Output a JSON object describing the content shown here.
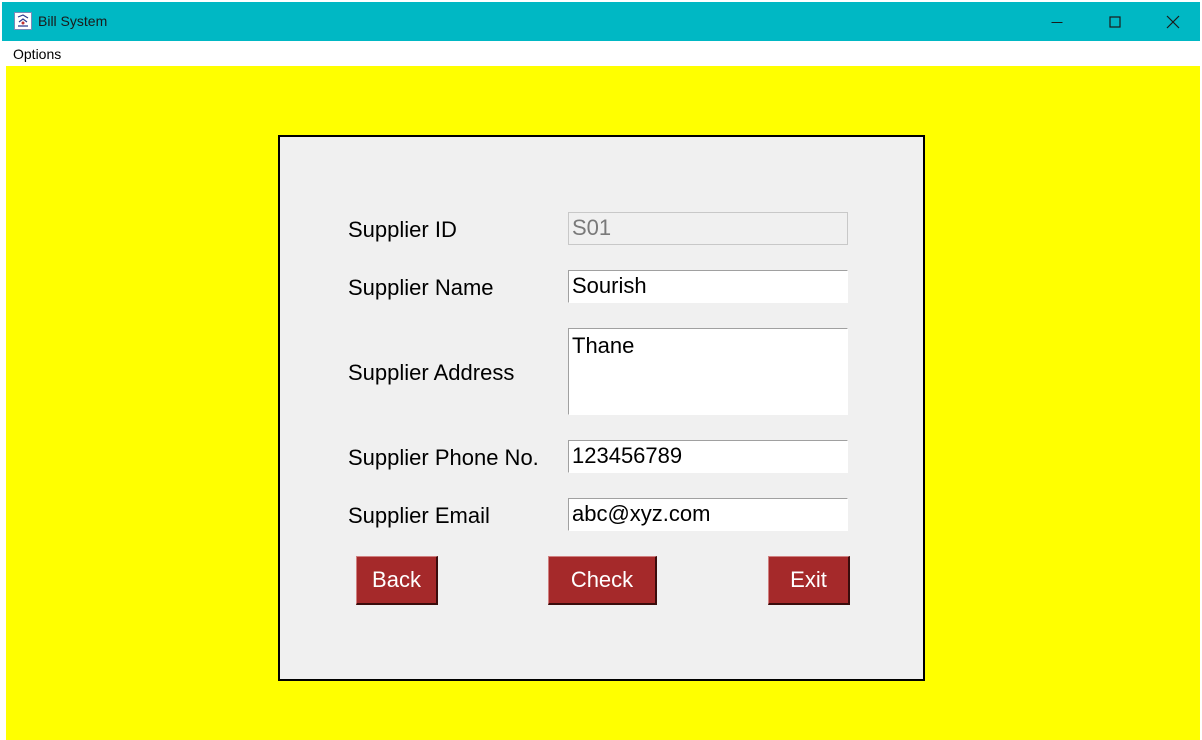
{
  "window": {
    "title": "Bill System",
    "controls": {
      "minimize": "minimize-icon",
      "maximize": "maximize-icon",
      "close": "close-icon"
    }
  },
  "menu": {
    "options_label": "Options"
  },
  "form": {
    "supplier_id": {
      "label": "Supplier ID",
      "value": "S01"
    },
    "supplier_name": {
      "label": "Supplier Name",
      "value": "Sourish"
    },
    "supplier_address": {
      "label": "Supplier Address",
      "value": "Thane"
    },
    "supplier_phone": {
      "label": "Supplier Phone No.",
      "value": "123456789"
    },
    "supplier_email": {
      "label": "Supplier Email",
      "value": "abc@xyz.com"
    }
  },
  "buttons": {
    "back": "Back",
    "check": "Check",
    "exit": "Exit"
  },
  "colors": {
    "titlebar": "#00b8c4",
    "background": "#ffff00",
    "panel": "#f0f0f0",
    "button": "#a5292a",
    "button_text": "#ffffff"
  }
}
